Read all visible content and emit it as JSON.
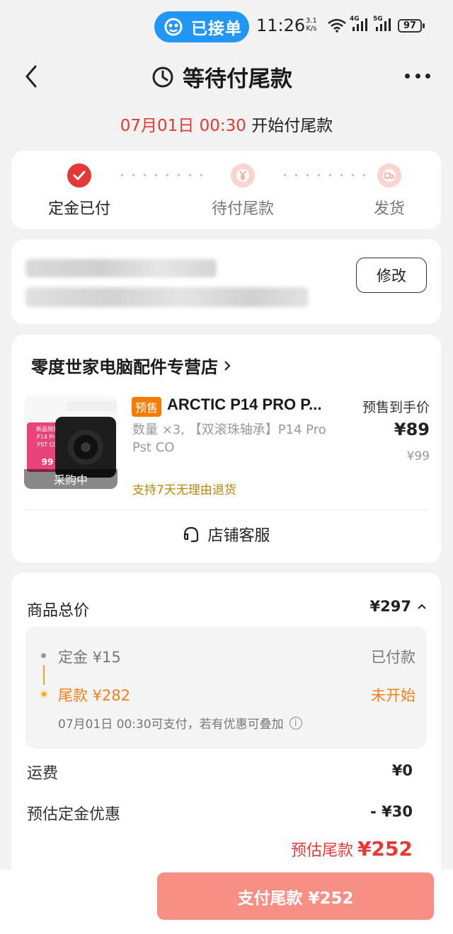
{
  "status_bar": {
    "pill_label": "已接单",
    "time": "11:26",
    "net_speed_value": "3.1",
    "net_speed_unit": "K/s",
    "sig1_label": "4G",
    "sig2_label": "5G",
    "battery": "97"
  },
  "header": {
    "title": "等待付尾款"
  },
  "countdown": {
    "time": "07月01日 00:30",
    "text": " 开始付尾款"
  },
  "steps": [
    {
      "label": "定金已付",
      "state": "done"
    },
    {
      "label": "待付尾款",
      "state": "pending"
    },
    {
      "label": "发货",
      "state": "pending"
    }
  ],
  "address": {
    "edit_label": "修改"
  },
  "shop": {
    "name": "零度世家电脑配件专营店",
    "product": {
      "badge": "预售",
      "name": "ARCTIC  P14 PRO P...",
      "spec": "数量 ×3, 【双滚珠轴承】P14 Pro Pst CO",
      "price_label": "预售到手价",
      "price": "¥89",
      "orig_price": "¥99",
      "return_note": "支持7天无理由退货",
      "thumb_overlay": "采购中",
      "thumb_tag_line1": "新品预售",
      "thumb_tag_line2": "P14 Pro",
      "thumb_tag_line3": "PST CO",
      "thumb_tag_price": "99"
    },
    "service_label": "店铺客服"
  },
  "prices": {
    "total_label": "商品总价",
    "total_value": "¥297",
    "deposit": "定金 ¥15",
    "deposit_status": "已付款",
    "balance": "尾款 ¥282",
    "balance_status": "未开始",
    "balance_note": "07月01日 00:30可支付，若有优惠可叠加",
    "shipping_label": "运费",
    "shipping_value": "¥0",
    "discount_label": "预估定金优惠",
    "discount_value": "- ¥30",
    "estimate_label": "预估尾款",
    "estimate_value": "¥252"
  },
  "bottom": {
    "pay_label": "支付尾款 ¥252"
  },
  "colors": {
    "accent_red": "#e53935",
    "orange": "#f0801a",
    "pay_button": "#f78f85",
    "pill_blue": "#2196f3"
  }
}
